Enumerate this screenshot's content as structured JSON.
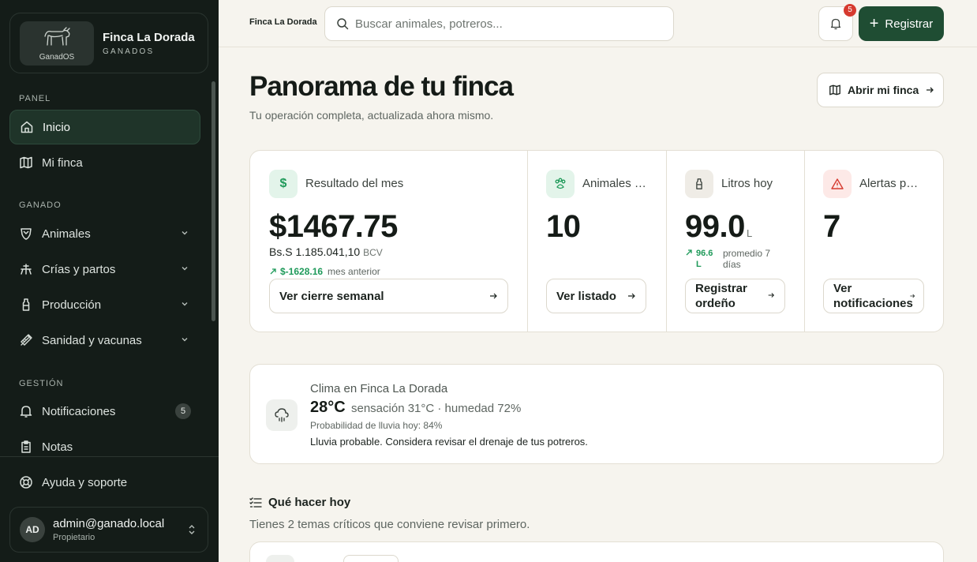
{
  "brand": {
    "name": "Finca La Dorada",
    "subtitle": "GANADOS",
    "logo_text": "GanadOS"
  },
  "nav": {
    "sections": {
      "panel": "PANEL",
      "ganado": "GANADO",
      "gestion": "GESTIÓN"
    },
    "items": [
      {
        "label": "Inicio",
        "icon": "home-icon",
        "active": true
      },
      {
        "label": "Mi finca",
        "icon": "map-icon"
      },
      {
        "label": "Animales",
        "icon": "shield-icon",
        "expandable": true
      },
      {
        "label": "Crías y partos",
        "icon": "baby-icon",
        "expandable": true
      },
      {
        "label": "Producción",
        "icon": "bottle-icon",
        "expandable": true
      },
      {
        "label": "Sanidad y vacunas",
        "icon": "syringe-icon",
        "expandable": true
      },
      {
        "label": "Notificaciones",
        "icon": "bell-icon",
        "badge": "5"
      },
      {
        "label": "Notas",
        "icon": "clipboard-icon"
      }
    ],
    "help": "Ayuda y soporte"
  },
  "user": {
    "initials": "AD",
    "email": "admin@ganado.local",
    "role": "Propietario"
  },
  "topbar": {
    "crumb": "Finca La Dorada",
    "search_placeholder": "Buscar animales, potreros...",
    "notif_count": "5",
    "register_label": "Registrar"
  },
  "page": {
    "title": "Panorama de tu finca",
    "subtitle": "Tu operación completa, actualizada ahora mismo.",
    "open_farm": "Abrir mi finca"
  },
  "stats": {
    "result": {
      "label": "Resultado del mes",
      "value": "$1467.75",
      "bs": "Bs.S 1.185.041,10",
      "bcv": "BCV",
      "delta": "$-1628.16",
      "delta_note": "mes anterior",
      "button": "Ver cierre semanal"
    },
    "animals": {
      "label": "Animales activos",
      "value": "10",
      "button": "Ver listado"
    },
    "liters": {
      "label": "Litros hoy",
      "value": "99.0",
      "unit": "L",
      "avg_value": "96.6",
      "avg_unit": "L",
      "avg_note": "promedio 7 días",
      "button": "Registrar ordeño"
    },
    "alerts": {
      "label": "Alertas pendientes",
      "value": "7",
      "button": "Ver notificaciones"
    }
  },
  "weather": {
    "title": "Clima en Finca La Dorada",
    "temp": "28°C",
    "feel": "sensación 31°C · humedad 72%",
    "rain": "Probabilidad de lluvia hoy: 84%",
    "advice": "Lluvia probable. Considera revisar el drenaje de tus potreros."
  },
  "today": {
    "heading": "Qué hacer hoy",
    "subtitle": "Tienes 2 temas críticos que conviene revisar primero."
  },
  "colors": {
    "sidebar": "#141c18",
    "accent": "#1f4d33",
    "positive": "#1f9a5a",
    "alert": "#d63a2f"
  }
}
